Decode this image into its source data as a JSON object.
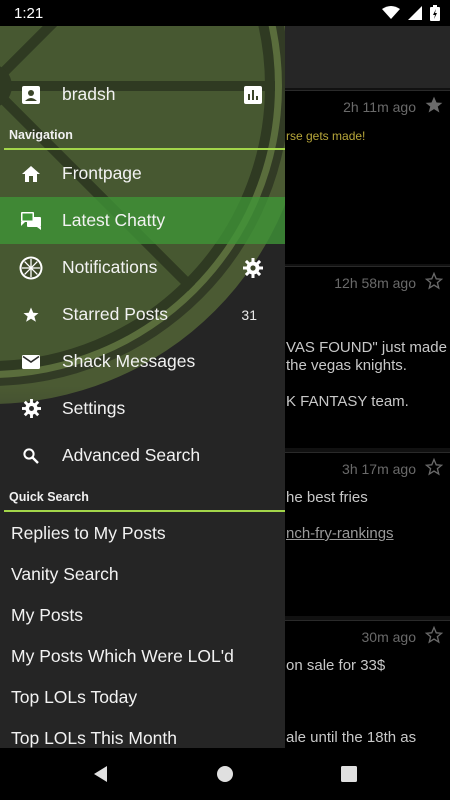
{
  "status_bar": {
    "time": "1:21"
  },
  "drawer": {
    "user": {
      "name": "bradsh"
    },
    "navigation_header": "Navigation",
    "nav_items": [
      {
        "label": "Frontpage",
        "icon": "home-icon"
      },
      {
        "label": "Latest Chatty",
        "icon": "chat-icon",
        "active": true
      },
      {
        "label": "Notifications",
        "icon": "lime-icon"
      },
      {
        "label": "Starred Posts",
        "icon": "star-icon",
        "badge": "31"
      },
      {
        "label": "Shack Messages",
        "icon": "mail-icon"
      },
      {
        "label": "Settings",
        "icon": "gear-icon"
      },
      {
        "label": "Advanced Search",
        "icon": "search-icon"
      }
    ],
    "quick_search_header": "Quick Search",
    "quick_search_items": [
      "Replies to My Posts",
      "Vanity Search",
      "My Posts",
      "My Posts Which Were LOL'd",
      "Top LOLs Today",
      "Top LOLs This Month"
    ]
  },
  "background_posts": [
    {
      "time": "2h 11m ago",
      "tag": "rse gets made!"
    },
    {
      "time": "12h 58m ago",
      "lines": [
        "VAS FOUND\" just made",
        "the vegas knights.",
        "K FANTASY team."
      ]
    },
    {
      "time": "3h 17m ago",
      "lines": [
        "he best fries",
        "nch-fry-rankings"
      ]
    },
    {
      "time": "30m ago",
      "lines": [
        "on sale for 33$",
        "ale until the 18th as"
      ]
    }
  ],
  "colors": {
    "accent": "#a3d64a",
    "active_row": "#3f9637",
    "drawer_bg": "#252525"
  }
}
